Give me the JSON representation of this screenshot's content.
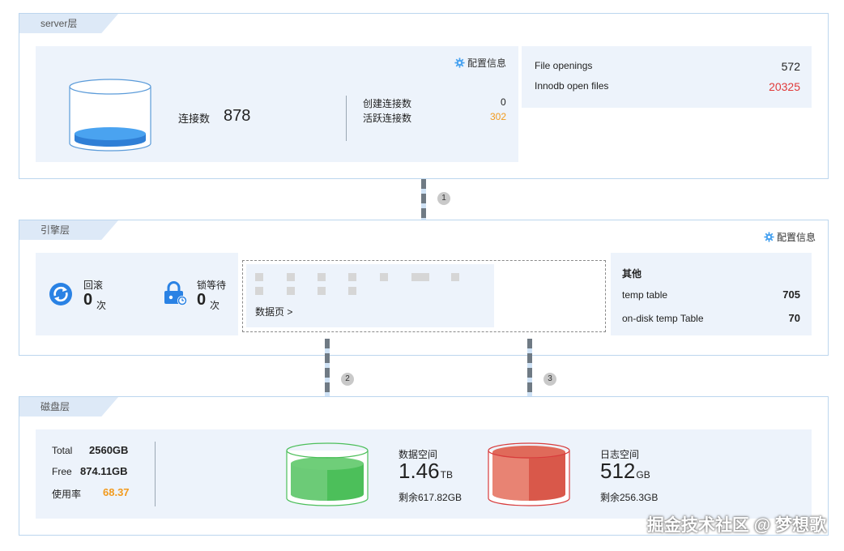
{
  "server": {
    "tag": "server层",
    "config_label": "配置信息",
    "connections_label": "连接数",
    "connections_value": "878",
    "created_label": "创建连接数",
    "created_value": "0",
    "active_label": "活跃连接数",
    "active_value": "302",
    "file_openings_label": "File openings",
    "file_openings_value": "572",
    "innodb_label": "Innodb open files",
    "innodb_value": "20325"
  },
  "connector_labels": [
    "1",
    "2",
    "3"
  ],
  "engine": {
    "tag": "引擎层",
    "config_label": "配置信息",
    "rollback_label": "回滚",
    "rollback_value": "0",
    "rollback_unit": "次",
    "lockwait_label": "锁等待",
    "lockwait_value": "0",
    "lockwait_unit": "次",
    "data_page_link": "数据页 >",
    "other_title": "其他",
    "temp_table_label": "temp table",
    "temp_table_value": "705",
    "ondisk_label": "on-disk temp Table",
    "ondisk_value": "70"
  },
  "disk": {
    "tag": "磁盘层",
    "total_label": "Total",
    "total_value": "2560GB",
    "free_label": "Free",
    "free_value": "874.11GB",
    "usage_label": "使用率",
    "usage_value": "68.37",
    "data_space_label": "数据空间",
    "data_space_value": "1.46",
    "data_space_unit": "TB",
    "data_space_remaining": "剩余617.82GB",
    "log_space_label": "日志空间",
    "log_space_value": "512",
    "log_space_unit": "GB",
    "log_space_remaining": "剩余256.3GB"
  },
  "watermark": "掘金技术社区 @ 梦想歌",
  "colors": {
    "accent": "#2a82e4",
    "danger": "#e03a3a",
    "warning": "#f29a1d",
    "green": "#4cbf5a",
    "red": "#d9584a"
  }
}
